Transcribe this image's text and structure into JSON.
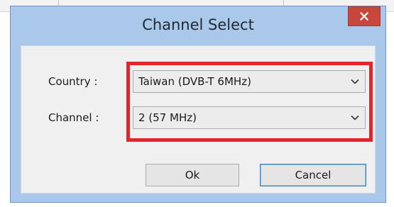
{
  "dialog": {
    "title": "Channel Select",
    "close_icon": "close-icon"
  },
  "form": {
    "country_label": "Country :",
    "country_value": "Taiwan (DVB-T 6MHz)",
    "channel_label": "Channel :",
    "channel_value": "2 (57 MHz)"
  },
  "buttons": {
    "ok_label": "Ok",
    "cancel_label": "Cancel"
  },
  "colors": {
    "highlight": "#e1252b",
    "titlebar": "#a9c8ea",
    "close_button": "#c7473c"
  }
}
